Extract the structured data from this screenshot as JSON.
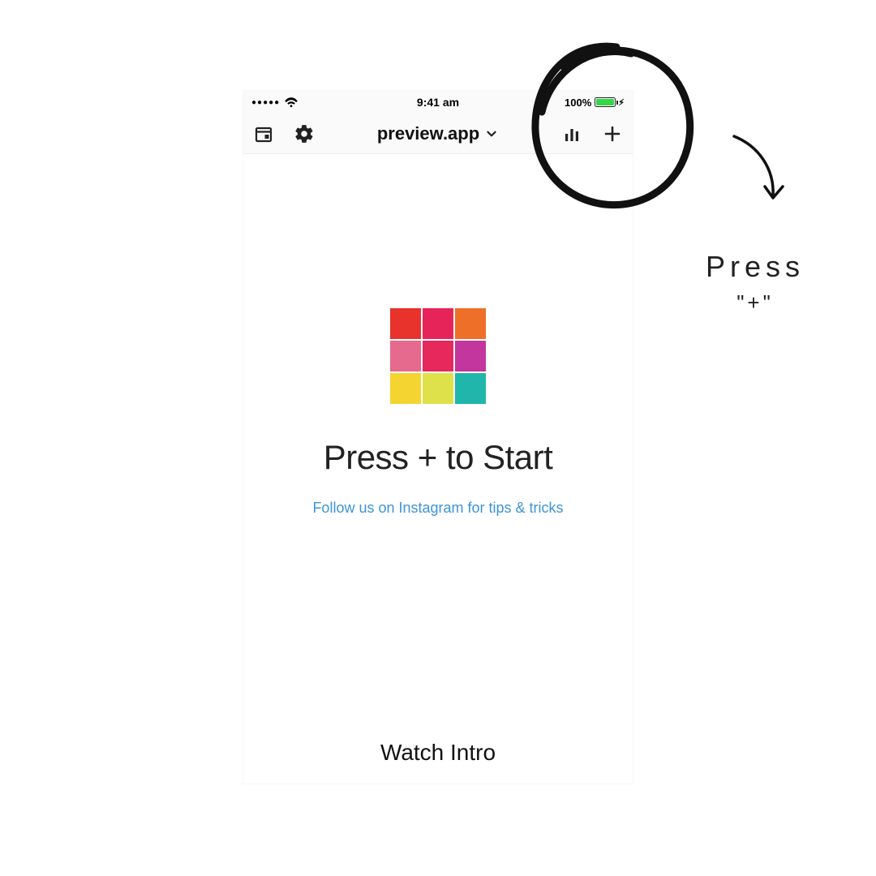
{
  "statusbar": {
    "time": "9:41 am",
    "battery_pct": "100%"
  },
  "toolbar": {
    "title": "preview.app"
  },
  "main": {
    "headline": "Press + to Start",
    "tips_link": "Follow us on Instagram for tips & tricks",
    "footer": "Watch Intro"
  },
  "logo_colors": {
    "c1": "#e7332c",
    "c2": "#e7245a",
    "c3": "#ee6f27",
    "c4": "#e66a8e",
    "c5": "#e6285d",
    "c6": "#c3369e",
    "c7": "#f4d430",
    "c8": "#dfe14a",
    "c9": "#20b6ab"
  },
  "annotation": {
    "line1": "Press",
    "line2": "\"+\""
  }
}
